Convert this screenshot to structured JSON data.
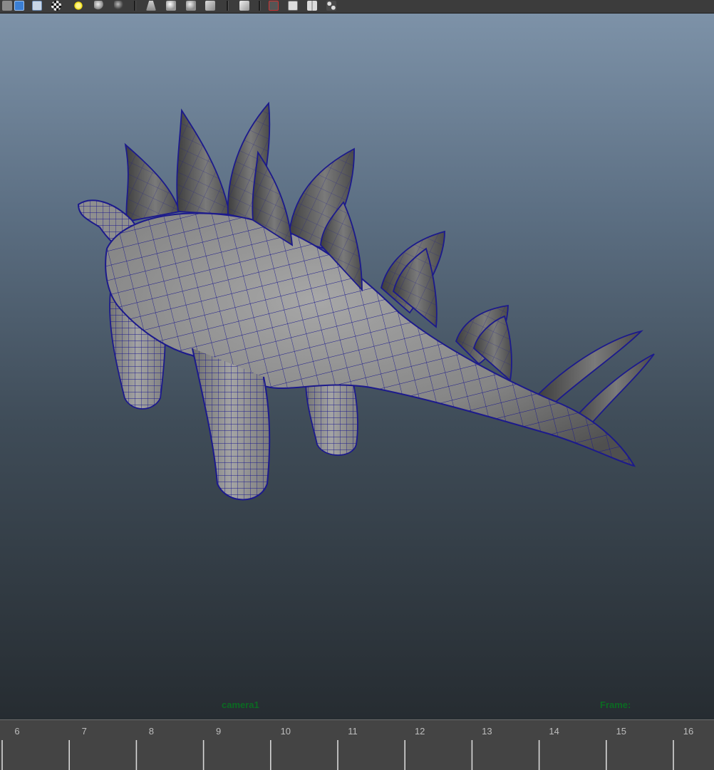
{
  "toolbar": {
    "icons": [
      "select-object-icon",
      "display-cube-icon",
      "wireframe-cube-icon",
      "checker-texture-icon",
      "light-bulb-icon",
      "sphere-shaded-icon",
      "sphere-dark-icon",
      "camera-attributes-icon",
      "shaded-display-icon",
      "smooth-shade-icon",
      "flat-shade-icon",
      "xray-icon",
      "isolate-select-icon",
      "panel-layout-icon",
      "two-panel-icon",
      "node-graph-icon"
    ]
  },
  "viewport": {
    "camera_label": "camera1",
    "frame_label": "Frame:",
    "hud_color": "#0b6a22",
    "wireframe_color": "#1c1a8c"
  },
  "timeslider": {
    "frames": [
      "6",
      "7",
      "8",
      "9",
      "10",
      "11",
      "12",
      "13",
      "14",
      "15",
      "16"
    ]
  }
}
